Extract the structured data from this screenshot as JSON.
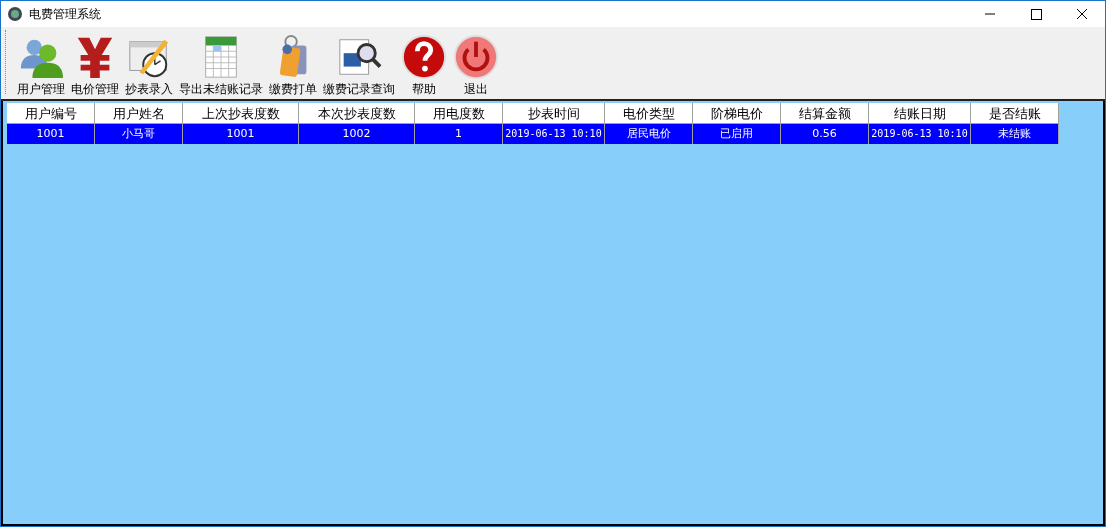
{
  "window": {
    "title": "电费管理系统"
  },
  "toolbar": [
    {
      "label": "用户管理",
      "kind": "users"
    },
    {
      "label": "电价管理",
      "kind": "yen"
    },
    {
      "label": "抄表录入",
      "kind": "calendar"
    },
    {
      "label": "导出未结账记录",
      "kind": "sheet"
    },
    {
      "label": "缴费打单",
      "kind": "tags"
    },
    {
      "label": "缴费记录查询",
      "kind": "search"
    },
    {
      "label": "帮助",
      "kind": "help"
    },
    {
      "label": "退出",
      "kind": "power"
    }
  ],
  "table": {
    "columns": [
      "用户编号",
      "用户姓名",
      "上次抄表度数",
      "本次抄表度数",
      "用电度数",
      "抄表时间",
      "电价类型",
      "阶梯电价",
      "结算金额",
      "结账日期",
      "是否结账"
    ],
    "rows": [
      {
        "selected": true,
        "cells": [
          "1001",
          "小马哥",
          "1001",
          "1002",
          "1",
          "2019-06-13 10:10",
          "居民电价",
          "已启用",
          "0.56",
          "2019-06-13 10:10",
          "未结账"
        ]
      }
    ]
  }
}
